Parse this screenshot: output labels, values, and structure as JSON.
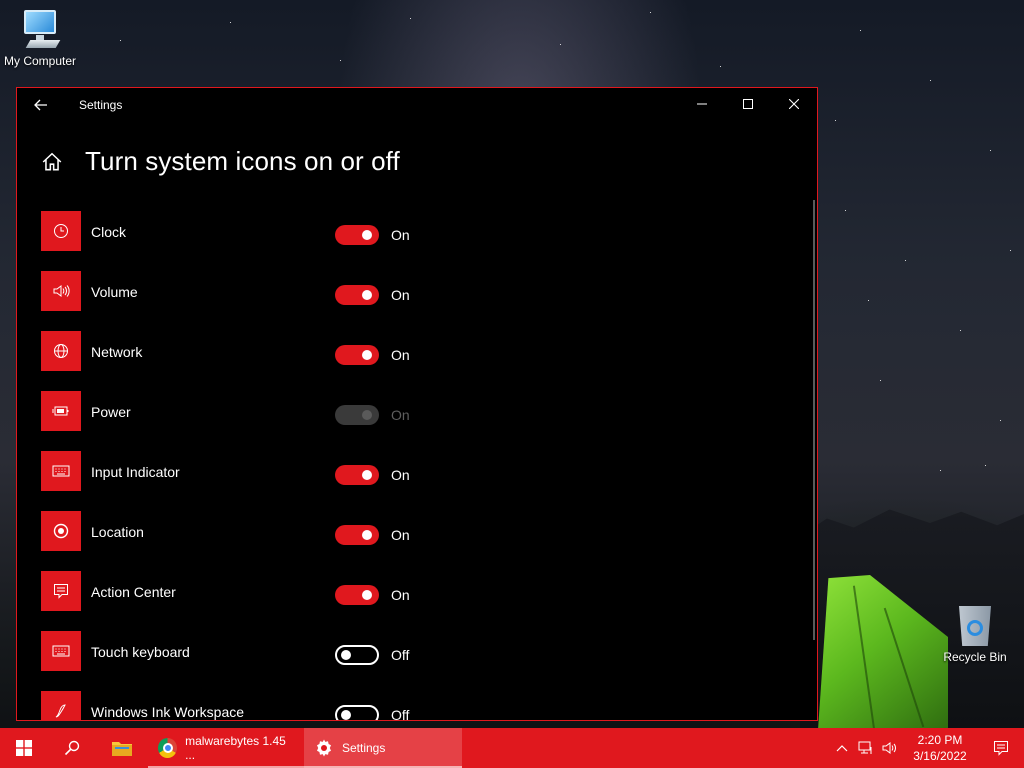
{
  "desktop": {
    "icons": [
      {
        "label": "My Computer"
      },
      {
        "label": "Recycle Bin"
      }
    ]
  },
  "window": {
    "title": "Settings",
    "page_title": "Turn system icons on or off",
    "accent": "#e0181e",
    "items": [
      {
        "label": "Clock",
        "icon": "clock-icon",
        "state": "On",
        "enabled": true
      },
      {
        "label": "Volume",
        "icon": "volume-icon",
        "state": "On",
        "enabled": true
      },
      {
        "label": "Network",
        "icon": "globe-icon",
        "state": "On",
        "enabled": true
      },
      {
        "label": "Power",
        "icon": "battery-icon",
        "state": "On",
        "enabled": false
      },
      {
        "label": "Input Indicator",
        "icon": "keyboard-icon",
        "state": "On",
        "enabled": true
      },
      {
        "label": "Location",
        "icon": "location-icon",
        "state": "On",
        "enabled": true
      },
      {
        "label": "Action Center",
        "icon": "action-center-icon",
        "state": "On",
        "enabled": true
      },
      {
        "label": "Touch keyboard",
        "icon": "touch-keyboard-icon",
        "state": "Off",
        "enabled": true
      },
      {
        "label": "Windows Ink Workspace",
        "icon": "pen-icon",
        "state": "Off",
        "enabled": true
      }
    ]
  },
  "taskbar": {
    "apps": [
      {
        "label": "malwarebytes 1.45 ...",
        "icon": "chrome-icon"
      },
      {
        "label": "Settings",
        "icon": "gear-icon"
      }
    ],
    "clock": {
      "time": "2:20 PM",
      "date": "3/16/2022"
    }
  }
}
